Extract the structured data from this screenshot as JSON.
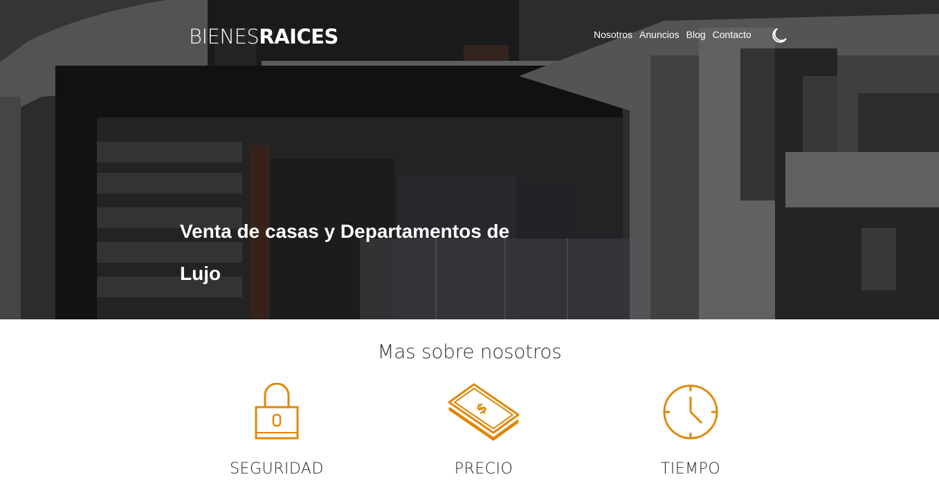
{
  "header": {
    "logo_thin": "BIENES",
    "logo_bold": "RAICES",
    "nav": {
      "item_1": "Nosotros",
      "item_2": "Anuncios",
      "item_3": "Blog",
      "item_4": "Contacto"
    },
    "theme_toggle_icon": "moon-icon"
  },
  "hero": {
    "title": "Venta de casas y Departamentos de Lujo"
  },
  "about": {
    "title": "Mas sobre nosotros",
    "features": [
      {
        "icon": "lock-icon",
        "label": "SEGURIDAD"
      },
      {
        "icon": "money-icon",
        "label": "PRECIO"
      },
      {
        "icon": "clock-icon",
        "label": "TIEMPO"
      }
    ]
  },
  "colors": {
    "accent": "#e08709",
    "hero_overlay": "#000000",
    "text_dark": "#333333"
  }
}
